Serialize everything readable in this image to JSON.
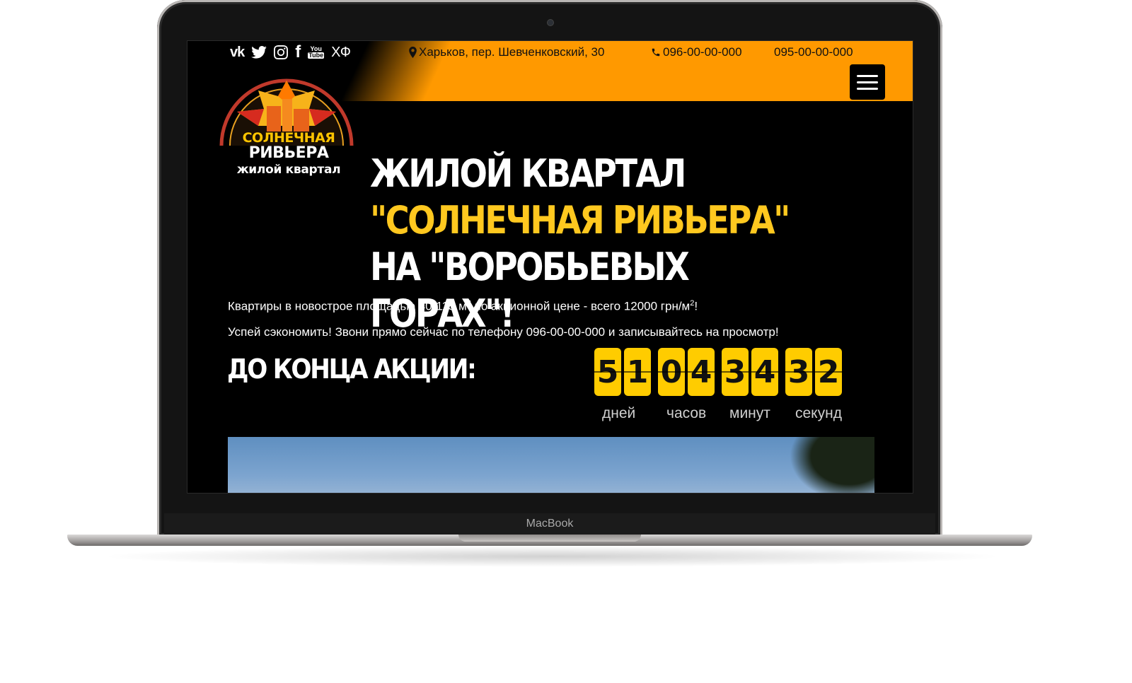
{
  "device": {
    "brand_label": "MacBook"
  },
  "header": {
    "social": [
      {
        "icon": "vk-icon",
        "label": "vk"
      },
      {
        "icon": "twitter-icon"
      },
      {
        "icon": "instagram-icon"
      },
      {
        "icon": "facebook-icon",
        "label": "f"
      },
      {
        "icon": "youtube-icon",
        "label_top": "You",
        "label_bottom": "Tube"
      },
      {
        "icon": "hf-icon",
        "label": "ХФ"
      }
    ],
    "address": "Харьков, пер. Шевченковский, 30",
    "phone_1": "096-00-00-000",
    "phone_2": "095-00-00-000",
    "accent_color": "#ff9900"
  },
  "logo": {
    "line_1": "СОЛНЕЧНАЯ",
    "line_2": "РИВЬЕРА",
    "line_3": "жилой квартал"
  },
  "hero": {
    "line_1": "ЖИЛОЙ КВАРТАЛ",
    "line_2": "\"СОЛНЕЧНАЯ РИВЬЕРА\"",
    "line_3": "НА \"ВОРОБЬЕВЫХ ГОРАХ\"!",
    "highlight_color": "#ffc81f"
  },
  "description": {
    "text_a": "Квартиры в новострое площадью 40-115 м",
    "sup_a": "2",
    "text_b": " по акционной цене - всего 12000 грн/м",
    "sup_b": "2",
    "text_c": "!",
    "line_2": "Успей сэкономить! Звони прямо сейчас по телефону 096-00-00-000 и записывайтесь на просмотр!"
  },
  "countdown": {
    "title": "ДО КОНЦА АКЦИИ:",
    "digits": [
      "5",
      "1",
      "0",
      "4",
      "3",
      "4",
      "3",
      "2"
    ],
    "labels": [
      "дней",
      "часов",
      "минут",
      "секунд"
    ],
    "digit_color": "#ffcc00"
  }
}
